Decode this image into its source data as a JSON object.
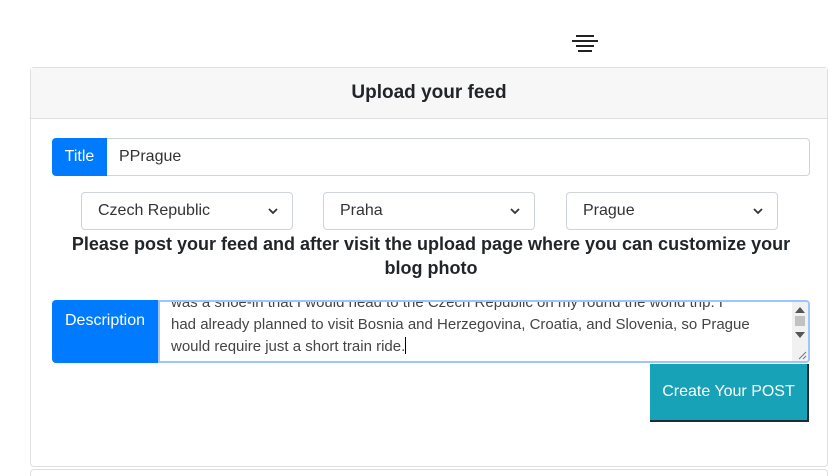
{
  "header": {
    "menu_icon": "hamburger-menu-icon"
  },
  "form": {
    "heading": "Upload your feed",
    "title_label": "Title",
    "title_value": "PPrague",
    "country": "Czech Republic",
    "region": "Praha",
    "city": "Prague",
    "prompt": "Please post your feed and after visit the upload page where you can customize your blog photo",
    "description_label": "Description",
    "description_lines": [
      "was a shoe-in that I would head to the Czech Republic on my round the world trip. I",
      "had already planned to visit Bosnia and Herzegovina, Croatia, and Slovenia, so Prague",
      "would require just a short train ride."
    ],
    "submit_label": "Create Your POST"
  },
  "colors": {
    "primary": "#007bff",
    "info": "#17a2b8"
  }
}
